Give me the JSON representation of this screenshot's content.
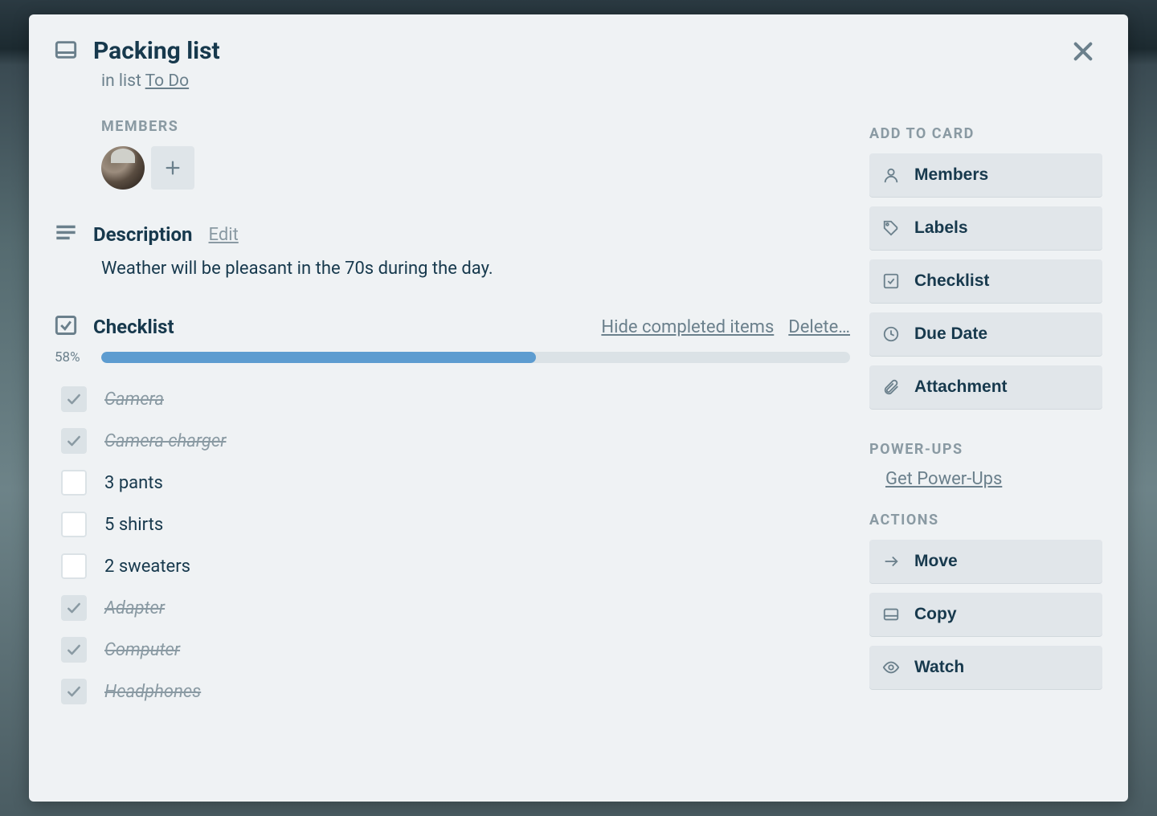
{
  "card": {
    "title": "Packing list",
    "in_list_prefix": "in list ",
    "list_name": "To Do"
  },
  "members": {
    "label": "MEMBERS"
  },
  "description": {
    "title": "Description",
    "edit_label": "Edit",
    "body": "Weather will be pleasant in the 70s during the day."
  },
  "checklist": {
    "title": "Checklist",
    "hide_label": "Hide completed items",
    "delete_label": "Delete…",
    "percent": "58%",
    "percent_value": 58,
    "items": [
      {
        "label": "Camera",
        "done": true
      },
      {
        "label": "Camera charger",
        "done": true
      },
      {
        "label": "3 pants",
        "done": false
      },
      {
        "label": "5 shirts",
        "done": false
      },
      {
        "label": "2 sweaters",
        "done": false
      },
      {
        "label": "Adapter",
        "done": true
      },
      {
        "label": "Computer",
        "done": true
      },
      {
        "label": "Headphones",
        "done": true
      }
    ]
  },
  "sidebar": {
    "add_label": "ADD TO CARD",
    "add_buttons": [
      {
        "icon": "person",
        "label": "Members"
      },
      {
        "icon": "tag",
        "label": "Labels"
      },
      {
        "icon": "check",
        "label": "Checklist"
      },
      {
        "icon": "clock",
        "label": "Due Date"
      },
      {
        "icon": "clip",
        "label": "Attachment"
      }
    ],
    "powerups_label": "POWER-UPS",
    "powerups_link": "Get Power-Ups",
    "actions_label": "ACTIONS",
    "action_buttons": [
      {
        "icon": "arrow",
        "label": "Move"
      },
      {
        "icon": "card",
        "label": "Copy"
      },
      {
        "icon": "eye",
        "label": "Watch"
      }
    ]
  }
}
